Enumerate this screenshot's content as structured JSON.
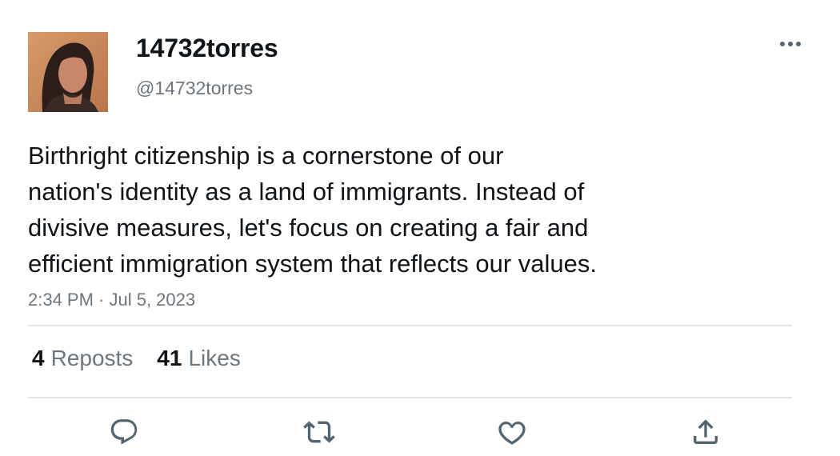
{
  "author": {
    "display_name": "14732torres",
    "handle": "@14732torres"
  },
  "tweet": {
    "text_lines": [
      "Birthright citizenship is a cornerstone of our",
      "nation's identity as a land of immigrants. Instead of",
      "divisive measures, let's focus on creating a fair and",
      "efficient immigration system that reflects our values."
    ],
    "timestamp": "2:34 PM · Jul 5, 2023"
  },
  "stats": {
    "reposts_count": "4",
    "reposts_label": "Reposts",
    "likes_count": "41",
    "likes_label": "Likes"
  },
  "icons": {
    "more": "more-horizontal-icon",
    "reply": "reply-icon",
    "repost": "repost-icon",
    "like": "heart-icon",
    "share": "share-icon"
  },
  "colors": {
    "text_primary": "#0f1419",
    "text_secondary": "#6e767d",
    "divider": "#e1e4e6",
    "icon": "#536471"
  }
}
